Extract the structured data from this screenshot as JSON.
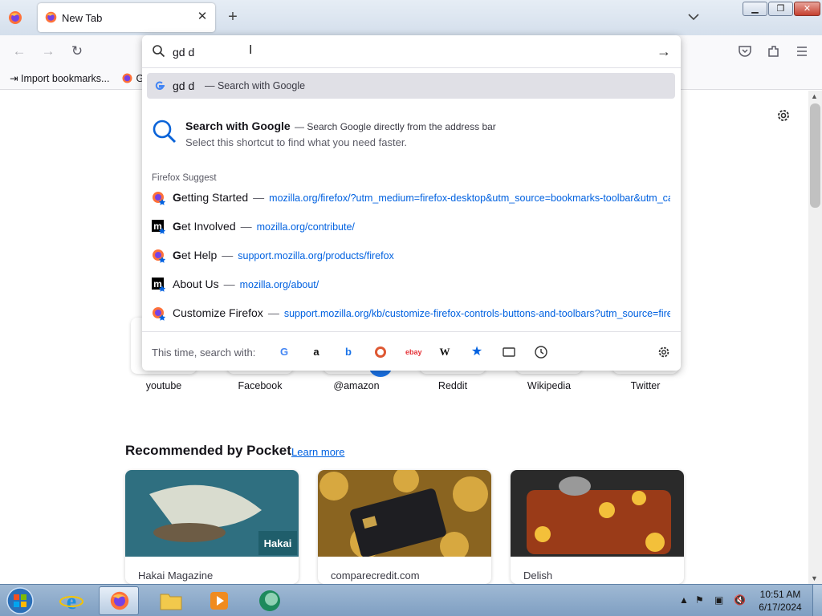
{
  "browser": {
    "tab_title": "New Tab",
    "bookmarks": {
      "import_label": "Import bookmarks...",
      "second_label": "G"
    }
  },
  "urlbar": {
    "value": "gd d",
    "selected_suggestion": {
      "query": "gd d",
      "action": "— Search with Google"
    },
    "shortcut_tip": {
      "title": "Search with Google",
      "desc": "— Search Google directly from the address bar",
      "subtitle": "Select this shortcut to find what you need faster."
    },
    "group_label": "Firefox Suggest",
    "results": [
      {
        "title_bold": "G",
        "title_rest": "etting Started",
        "url": "mozilla.org/firefox/?utm_medium=firefox-desktop&utm_source=bookmarks-toolbar&utm_ca",
        "icon": "firefox-icon"
      },
      {
        "title_bold": "G",
        "title_rest": "et Involved",
        "url": "mozilla.org/contribute/",
        "icon": "mozilla-m-icon"
      },
      {
        "title_bold": "G",
        "title_rest": "et Help",
        "url": "support.mozilla.org/products/firefox",
        "icon": "firefox-icon"
      },
      {
        "title_bold": "",
        "title_rest": "About Us",
        "url": "mozilla.org/about/",
        "icon": "mozilla-m-icon"
      },
      {
        "title_bold": "",
        "title_rest": "Customize Firefox",
        "url": "support.mozilla.org/kb/customize-firefox-controls-buttons-and-toolbars?utm_source=firef",
        "icon": "firefox-icon"
      }
    ],
    "oneoff_label": "This time, search with:",
    "engines": [
      "google",
      "amazon",
      "bing",
      "duckduckgo",
      "ebay",
      "wikipedia",
      "bookmarks",
      "tabs",
      "history"
    ]
  },
  "newtab": {
    "top_sites": [
      "youtube",
      "Facebook",
      "@amazon",
      "Reddit",
      "Wikipedia",
      "Twitter"
    ],
    "pocket_heading": "Recommended by Pocket",
    "pocket_link": "Learn more",
    "cards": [
      {
        "source": "Hakai Magazine",
        "badge": "Hakai"
      },
      {
        "source": "comparecredit.com"
      },
      {
        "source": "Delish"
      }
    ]
  },
  "taskbar": {
    "time": "10:51 AM",
    "date": "6/17/2024"
  },
  "colors": {
    "link_blue": "#0061e0",
    "selected_row": "#e0e0e6"
  }
}
